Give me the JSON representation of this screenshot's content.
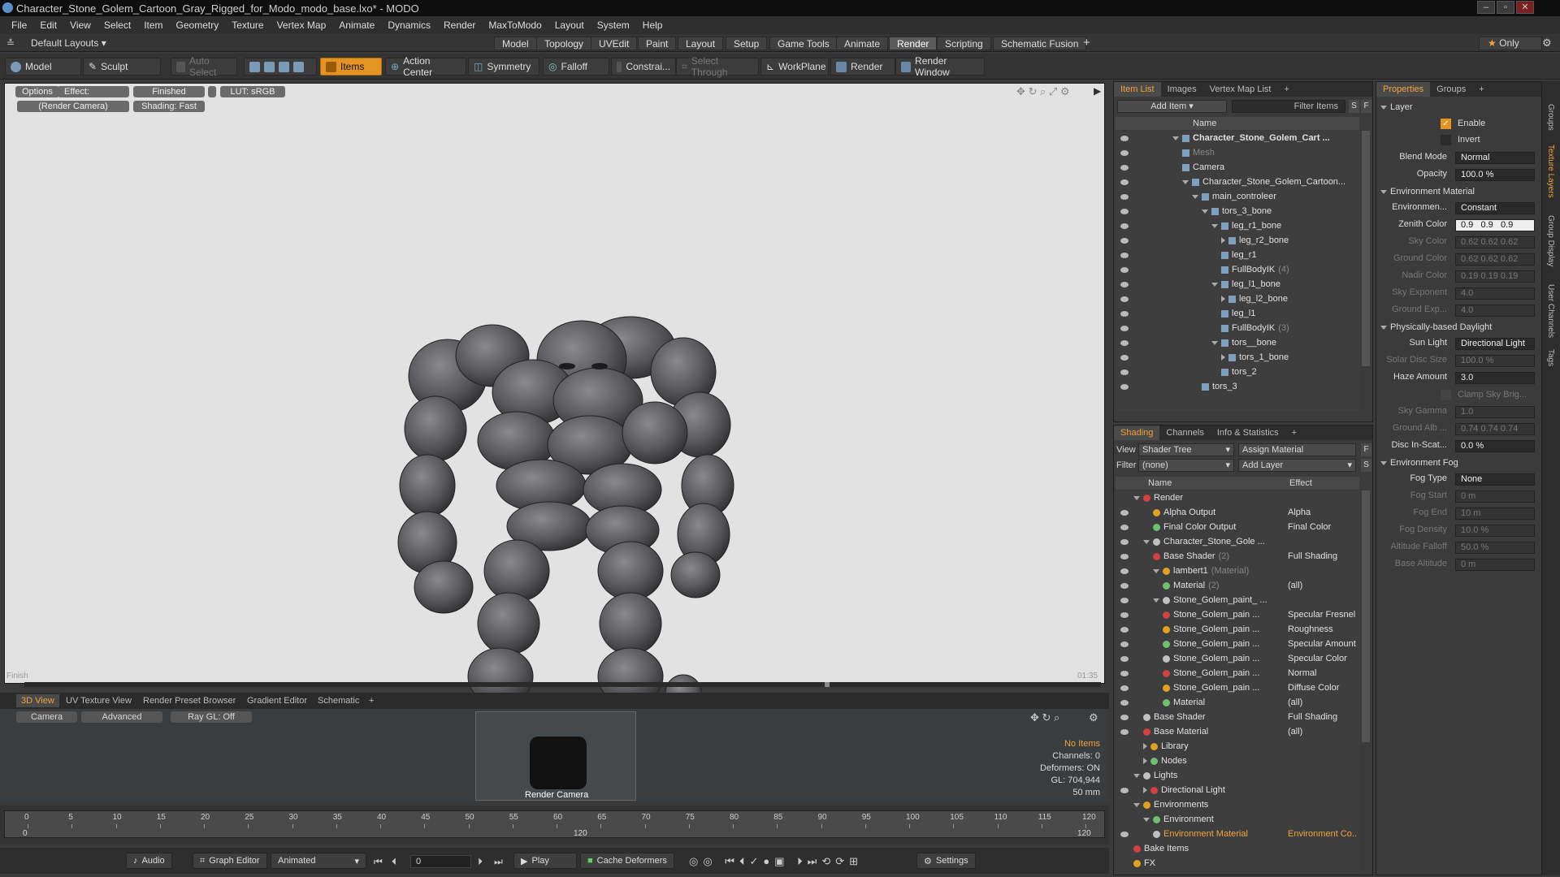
{
  "window": {
    "title": "Character_Stone_Golem_Cartoon_Gray_Rigged_for_Modo_modo_base.lxo* - MODO"
  },
  "menu": [
    "File",
    "Edit",
    "View",
    "Select",
    "Item",
    "Geometry",
    "Texture",
    "Vertex Map",
    "Animate",
    "Dynamics",
    "Render",
    "MaxToModo",
    "Layout",
    "System",
    "Help"
  ],
  "layout": {
    "dropdown": "Default Layouts",
    "tabs": [
      "Model",
      "Topology",
      "UVEdit",
      "Paint",
      "Layout",
      "Setup",
      "Game Tools",
      "Animate",
      "Render",
      "Scripting",
      "Schematic Fusion"
    ],
    "active_tab": "Render",
    "only_label": "Only"
  },
  "toolbar": {
    "model": "Model",
    "sculpt": "Sculpt",
    "auto_select": "Auto Select",
    "items": "Items",
    "action_center": "Action Center",
    "symmetry": "Symmetry",
    "falloff": "Falloff",
    "constraint": "Constrai...",
    "select_through": "Select Through",
    "workplane": "WorkPlane",
    "render": "Render",
    "render_window": "Render Window"
  },
  "viewport": {
    "options": "Options",
    "effect": "Effect: (Shadi...",
    "finished": "Finished",
    "lut": "LUT: sRGB",
    "camera": "(Render Camera)",
    "shading": "Shading: Fast",
    "status_left": "Finish",
    "status_right": "01:35"
  },
  "item_list": {
    "tabs": [
      "Item List",
      "Images",
      "Vertex Map List"
    ],
    "add_item": "Add Item",
    "filter_items": "Filter Items",
    "s_label": "S",
    "f_label": "F",
    "header": "Name",
    "rows": [
      {
        "label": "Character_Stone_Golem_Cart ...",
        "suffix": "",
        "depth": 0,
        "arrow": "down",
        "bold": true
      },
      {
        "label": "Mesh",
        "suffix": "",
        "depth": 1,
        "arrow": "",
        "dim": true
      },
      {
        "label": "Camera",
        "suffix": "",
        "depth": 1,
        "arrow": ""
      },
      {
        "label": "Character_Stone_Golem_Cartoon...",
        "suffix": "",
        "depth": 1,
        "arrow": "down"
      },
      {
        "label": "main_controleer",
        "suffix": "",
        "depth": 2,
        "arrow": "down"
      },
      {
        "label": "tors_3_bone",
        "suffix": "",
        "depth": 3,
        "arrow": "down"
      },
      {
        "label": "leg_r1_bone",
        "suffix": "",
        "depth": 4,
        "arrow": "down"
      },
      {
        "label": "leg_r2_bone",
        "suffix": "",
        "depth": 5,
        "arrow": "right"
      },
      {
        "label": "leg_r1",
        "suffix": "",
        "depth": 5,
        "arrow": ""
      },
      {
        "label": "FullBodyIK",
        "suffix": "(4)",
        "depth": 5,
        "arrow": ""
      },
      {
        "label": "leg_l1_bone",
        "suffix": "",
        "depth": 4,
        "arrow": "down"
      },
      {
        "label": "leg_l2_bone",
        "suffix": "",
        "depth": 5,
        "arrow": "right"
      },
      {
        "label": "leg_l1",
        "suffix": "",
        "depth": 5,
        "arrow": ""
      },
      {
        "label": "FullBodyIK",
        "suffix": "(3)",
        "depth": 5,
        "arrow": ""
      },
      {
        "label": "tors__bone",
        "suffix": "",
        "depth": 4,
        "arrow": "down"
      },
      {
        "label": "tors_1_bone",
        "suffix": "",
        "depth": 5,
        "arrow": "right"
      },
      {
        "label": "tors_2",
        "suffix": "",
        "depth": 5,
        "arrow": ""
      },
      {
        "label": "tors_3",
        "suffix": "",
        "depth": 3,
        "arrow": ""
      }
    ]
  },
  "shading": {
    "tabs": [
      "Shading",
      "Channels",
      "Info & Statistics"
    ],
    "view_label": "View",
    "view_value": "Shader Tree",
    "assign_material": "Assign Material",
    "filter_label": "Filter",
    "filter_value": "(none)",
    "add_layer": "Add Layer",
    "f_label": "F",
    "s_label": "S",
    "col_name": "Name",
    "col_effect": "Effect",
    "rows": [
      {
        "label": "Render",
        "suffix": "",
        "effect": "",
        "depth": 0,
        "arrow": "down",
        "eye": false
      },
      {
        "label": "Alpha Output",
        "suffix": "",
        "effect": "Alpha",
        "depth": 2,
        "arrow": "",
        "eye": true
      },
      {
        "label": "Final Color Output",
        "suffix": "",
        "effect": "Final Color",
        "depth": 2,
        "arrow": "",
        "eye": true
      },
      {
        "label": "Character_Stone_Gole ...",
        "suffix": "",
        "effect": "",
        "depth": 1,
        "arrow": "down",
        "eye": true
      },
      {
        "label": "Base Shader",
        "suffix": "(2)",
        "effect": "Full Shading",
        "depth": 2,
        "arrow": "",
        "eye": true
      },
      {
        "label": "lambert1",
        "suffix": "(Material)",
        "effect": "",
        "depth": 2,
        "arrow": "down",
        "eye": true
      },
      {
        "label": "Material",
        "suffix": "(2)",
        "effect": "(all)",
        "depth": 3,
        "arrow": "",
        "eye": true
      },
      {
        "label": "Stone_Golem_paint_ ...",
        "suffix": "",
        "effect": "",
        "depth": 2,
        "arrow": "down",
        "eye": true
      },
      {
        "label": "Stone_Golem_pain ...",
        "suffix": "",
        "effect": "Specular Fresnel",
        "depth": 3,
        "arrow": "",
        "eye": true
      },
      {
        "label": "Stone_Golem_pain ...",
        "suffix": "",
        "effect": "Roughness",
        "depth": 3,
        "arrow": "",
        "eye": true
      },
      {
        "label": "Stone_Golem_pain ...",
        "suffix": "",
        "effect": "Specular Amount",
        "depth": 3,
        "arrow": "",
        "eye": true
      },
      {
        "label": "Stone_Golem_pain ...",
        "suffix": "",
        "effect": "Specular Color",
        "depth": 3,
        "arrow": "",
        "eye": true
      },
      {
        "label": "Stone_Golem_pain ...",
        "suffix": "",
        "effect": "Normal",
        "depth": 3,
        "arrow": "",
        "eye": true
      },
      {
        "label": "Stone_Golem_pain ...",
        "suffix": "",
        "effect": "Diffuse Color",
        "depth": 3,
        "arrow": "",
        "eye": true
      },
      {
        "label": "Material",
        "suffix": "",
        "effect": "(all)",
        "depth": 3,
        "arrow": "",
        "eye": true
      },
      {
        "label": "Base Shader",
        "suffix": "",
        "effect": "Full Shading",
        "depth": 1,
        "arrow": "",
        "eye": true
      },
      {
        "label": "Base Material",
        "suffix": "",
        "effect": "(all)",
        "depth": 1,
        "arrow": "",
        "eye": true
      },
      {
        "label": "Library",
        "suffix": "",
        "effect": "",
        "depth": 1,
        "arrow": "right",
        "eye": false
      },
      {
        "label": "Nodes",
        "suffix": "",
        "effect": "",
        "depth": 1,
        "arrow": "right",
        "eye": false
      },
      {
        "label": "Lights",
        "suffix": "",
        "effect": "",
        "depth": 0,
        "arrow": "down",
        "eye": false
      },
      {
        "label": "Directional Light",
        "suffix": "",
        "effect": "",
        "depth": 1,
        "arrow": "right",
        "eye": true
      },
      {
        "label": "Environments",
        "suffix": "",
        "effect": "",
        "depth": 0,
        "arrow": "down",
        "eye": false
      },
      {
        "label": "Environment",
        "suffix": "",
        "effect": "",
        "depth": 1,
        "arrow": "down",
        "eye": false
      },
      {
        "label": "Environment Material",
        "suffix": "",
        "effect": "Environment Co...",
        "depth": 2,
        "arrow": "",
        "eye": true,
        "highlight": true
      },
      {
        "label": "Bake Items",
        "suffix": "",
        "effect": "",
        "depth": 0,
        "arrow": "",
        "eye": false
      },
      {
        "label": "FX",
        "suffix": "",
        "effect": "",
        "depth": 0,
        "arrow": "",
        "eye": false
      }
    ]
  },
  "properties": {
    "tabs": [
      "Properties",
      "Groups"
    ],
    "section_layer": "Layer",
    "enable": "Enable",
    "invert": "Invert",
    "blend_mode_label": "Blend Mode",
    "blend_mode": "Normal",
    "opacity_label": "Opacity",
    "opacity": "100.0 %",
    "section_env": "Environment Material",
    "env_type_label": "Environmen...",
    "env_type": "Constant",
    "zenith_label": "Zenith Color",
    "zenith": [
      "0.9",
      "0.9",
      "0.9"
    ],
    "sky_label": "Sky Color",
    "sky": "0.62  0.62  0.62",
    "ground_label": "Ground Color",
    "ground": "0.62  0.62  0.62",
    "nadir_label": "Nadir Color",
    "nadir": "0.19  0.19  0.19",
    "sky_exp_label": "Sky Exponent",
    "sky_exp": "4.0",
    "ground_exp_label": "Ground Exp...",
    "ground_exp": "4.0",
    "section_daylight": "Physically-based Daylight",
    "sun_label": "Sun Light",
    "sun": "Directional Light",
    "solar_label": "Solar Disc Size",
    "solar": "100.0 %",
    "haze_label": "Haze Amount",
    "haze": "3.0",
    "clamp": "Clamp Sky Brig...",
    "sky_gamma_label": "Sky Gamma",
    "sky_gamma": "1.0",
    "ground_alb_label": "Ground Alb ...",
    "ground_alb": "0.74  0.74  0.74",
    "disc_label": "Disc In-Scat...",
    "disc": "0.0 %",
    "section_fog": "Environment Fog",
    "fog_type_label": "Fog Type",
    "fog_type": "None",
    "fog_start_label": "Fog Start",
    "fog_start": "0 m",
    "fog_end_label": "Fog End",
    "fog_end": "10 m",
    "fog_density_label": "Fog Density",
    "fog_density": "10.0 %",
    "alt_falloff_label": "Altitude Falloff",
    "alt_falloff": "50.0 %",
    "base_alt_label": "Base Altitude",
    "base_alt": "0 m"
  },
  "side_tabs": [
    "Groups",
    "Texture Layers",
    "Group Display",
    "User Channels",
    "Tags"
  ],
  "bottom": {
    "tabs": [
      "3D View",
      "UV Texture View",
      "Render Preset Browser",
      "Gradient Editor",
      "Schematic"
    ],
    "camera": "Camera",
    "advanced": "Advanced",
    "raygl": "Ray GL: Off",
    "render_camera": "Render Camera",
    "info": [
      "No Items",
      "Channels: 0",
      "Deformers: ON",
      "GL: 704,944",
      "50 mm"
    ]
  },
  "timeline": {
    "ticks": [
      "0",
      "5",
      "10",
      "15",
      "20",
      "25",
      "30",
      "35",
      "40",
      "45",
      "50",
      "55",
      "60",
      "65",
      "70",
      "75",
      "80",
      "85",
      "90",
      "95",
      "100",
      "105",
      "110",
      "115",
      "120"
    ],
    "start": "0",
    "end": "120"
  },
  "transport": {
    "audio": "Audio",
    "graph_editor": "Graph Editor",
    "animated": "Animated",
    "frame": "0",
    "play": "Play",
    "cache": "Cache Deformers",
    "settings": "Settings"
  },
  "colors": {
    "accent": "#f2a33a",
    "items_button": "#e39422",
    "viewport_bg": "#e2e2e2",
    "highlight_text": "#f2a33a"
  }
}
